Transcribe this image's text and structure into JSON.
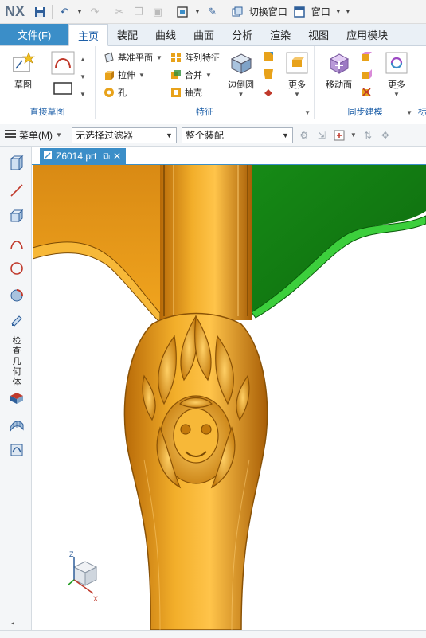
{
  "quick_access": {
    "logo": "NX",
    "switch_window": "切换窗口",
    "window_menu": "窗口"
  },
  "tabs": {
    "file": "文件(F)",
    "items": [
      "主页",
      "装配",
      "曲线",
      "曲面",
      "分析",
      "渲染",
      "视图",
      "应用模块"
    ],
    "active": "主页"
  },
  "ribbon": {
    "groups": {
      "direct_sketch": {
        "label": "直接草图",
        "sketch": "草图"
      },
      "feature": {
        "label": "特征",
        "datum_plane": "基准平面",
        "extrude": "拉伸",
        "hole": "孔",
        "pattern_feature": "阵列特征",
        "unite": "合并",
        "shell": "抽壳",
        "edge_blend": "边倒圆",
        "more": "更多"
      },
      "sync_modeling": {
        "label": "同步建模",
        "move_face": "移动面",
        "more": "更多"
      },
      "overflow_label": "标"
    }
  },
  "filter_bar": {
    "menu": "菜单(M)",
    "selection_filter": "无选择过滤器",
    "scope": "整个装配"
  },
  "sidebar": {
    "vertical_label": "检查几何体"
  },
  "document": {
    "tab_title": "Z6014.prt"
  },
  "triad": {
    "z": "Z",
    "x": "X"
  },
  "colors": {
    "accent": "#3b8ec8",
    "model_gold": "#e8a21a",
    "model_green": "#1f9a1f"
  }
}
